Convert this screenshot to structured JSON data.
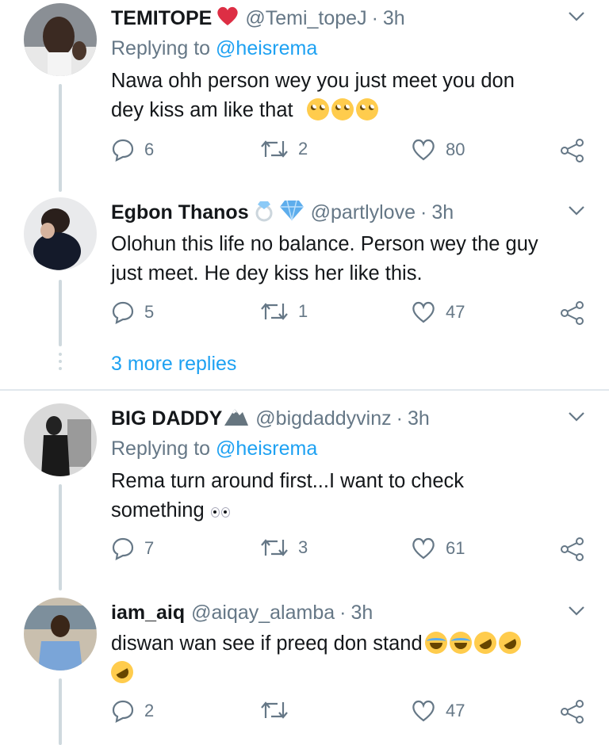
{
  "colors": {
    "link": "#1da1f2",
    "muted": "#657786",
    "text": "#14171a",
    "line": "#cfd9de"
  },
  "tweets": [
    {
      "name": "TEMITOPE",
      "name_emoji": "red-heart",
      "handle": "@Temi_topeJ",
      "time": "3h",
      "replying_prefix": "Replying to",
      "replying_to": "@heisrema",
      "text_line1": "Nawa ohh person wey you just meet you don",
      "text_line2": "dey kiss am like that",
      "text_emojis": [
        "face-with-rolling-eyes",
        "face-with-rolling-eyes",
        "face-with-rolling-eyes"
      ],
      "replies": "6",
      "retweets": "2",
      "likes": "80"
    },
    {
      "name": "Egbon Thanos",
      "name_emoji": "ring-and-gem",
      "handle": "@partlylove",
      "time": "3h",
      "text_line1": "Olohun this life no balance. Person wey the guy",
      "text_line2": "just meet. He dey kiss her like this.",
      "replies": "5",
      "retweets": "1",
      "likes": "47",
      "more_replies": "3 more replies"
    },
    {
      "name": "BIG DADDY",
      "name_emoji": "mountain",
      "handle": "@bigdaddyvinz",
      "time": "3h",
      "replying_prefix": "Replying to",
      "replying_to": "@heisrema",
      "text_line1": "Rema turn around first...I want to check",
      "text_line2": "something",
      "text_emojis": [
        "eyes"
      ],
      "replies": "7",
      "retweets": "3",
      "likes": "61"
    },
    {
      "name": "iam_aiq",
      "handle": "@aiqay_alamba",
      "time": "3h",
      "text_line1": "diswan wan see if preeq don stand",
      "text_emojis": [
        "face-with-tears-of-joy",
        "face-with-tears-of-joy",
        "rolling-on-the-floor-laughing",
        "rolling-on-the-floor-laughing",
        "rolling-on-the-floor-laughing"
      ],
      "replies": "2",
      "retweets": "",
      "likes": "47"
    }
  ]
}
